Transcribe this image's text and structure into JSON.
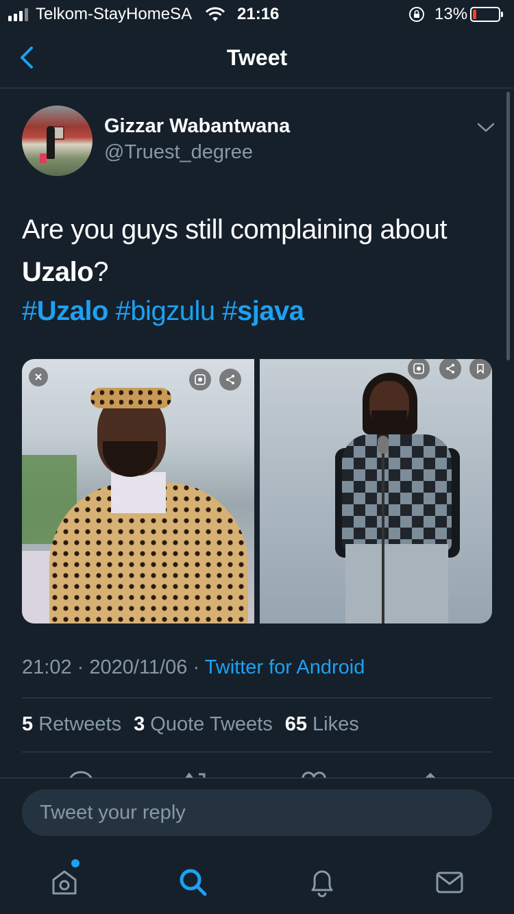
{
  "status_bar": {
    "carrier": "Telkom-StayHomeSA",
    "time": "21:16",
    "battery_percent": "13%",
    "battery_level": 0.13,
    "icons": [
      "signal-icon",
      "wifi-icon",
      "rotation-lock-icon",
      "battery-icon"
    ]
  },
  "header": {
    "title": "Tweet",
    "back_icon": "chevron-left-icon"
  },
  "tweet": {
    "author": {
      "display_name": "Gizzar Wabantwana",
      "handle": "@Truest_degree"
    },
    "text_prefix": "Are you guys still complaining about ",
    "text_bold": "Uzalo",
    "text_suffix": "?",
    "hashtags": [
      {
        "hash": "#",
        "tag": "Uzalo",
        "bold": true
      },
      {
        "hash": "#",
        "tag": "bigzulu",
        "bold": false
      },
      {
        "hash": "#",
        "tag": "sjava",
        "bold": true
      }
    ],
    "time": "21:02",
    "date": "2020/11/06",
    "separator": "·",
    "source": "Twitter for Android",
    "stats": {
      "retweets_count": "5",
      "retweets_label": "Retweets",
      "quotes_count": "3",
      "quotes_label": "Quote Tweets",
      "likes_count": "65",
      "likes_label": "Likes"
    }
  },
  "reply": {
    "placeholder": "Tweet your reply"
  },
  "tab_bar": {
    "tabs": [
      "home-icon",
      "search-icon",
      "notifications-icon",
      "messages-icon"
    ],
    "active": "search-icon"
  },
  "colors": {
    "background": "#15202b",
    "accent": "#1da1f2",
    "secondary_text": "#8899a6",
    "divider": "#38444d"
  }
}
